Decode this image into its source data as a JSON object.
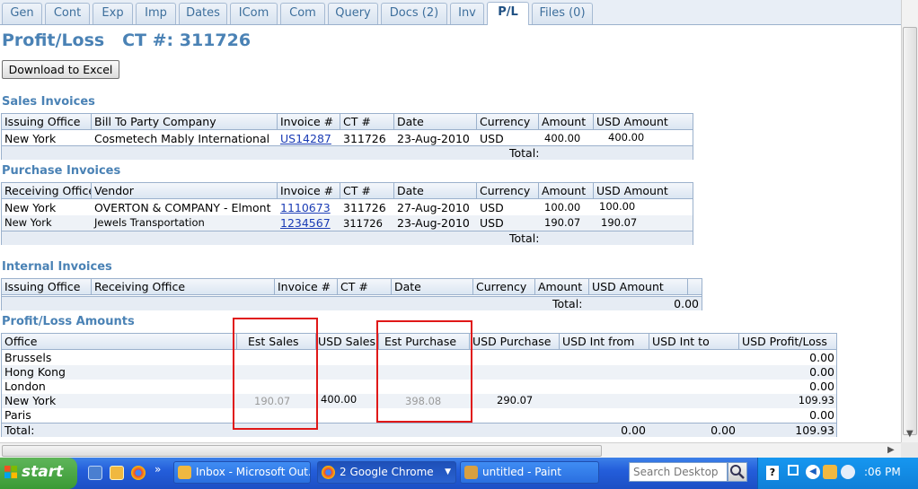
{
  "tabs": [
    {
      "label": "Gen"
    },
    {
      "label": "Cont"
    },
    {
      "label": "Exp"
    },
    {
      "label": "Imp"
    },
    {
      "label": "Dates"
    },
    {
      "label": "ICom"
    },
    {
      "label": "Com"
    },
    {
      "label": "Query"
    },
    {
      "label": "Docs (2)"
    },
    {
      "label": "Inv"
    },
    {
      "label": "P/L"
    },
    {
      "label": "Files (0)"
    }
  ],
  "active_tab": "P/L",
  "page": {
    "title": "Profit/Loss   CT #: 311726",
    "excel_button": "Download to Excel"
  },
  "sales": {
    "title": "Sales Invoices",
    "headers": [
      "Issuing Office",
      "Bill To Party Company",
      "Invoice #",
      "CT #",
      "Date",
      "Currency",
      "Amount",
      "USD Amount"
    ],
    "rows": [
      {
        "office": "New York",
        "company": "Cosmetech Mably International",
        "invoice": "US14287",
        "ct": "311726",
        "date": "23-Aug-2010",
        "currency": "USD",
        "amount": "400.00",
        "usd": "400.00"
      }
    ],
    "total_label": "Total:"
  },
  "purchase": {
    "title": "Purchase Invoices",
    "headers": [
      "Receiving Office",
      "Vendor",
      "Invoice #",
      "CT #",
      "Date",
      "Currency",
      "Amount",
      "USD Amount"
    ],
    "rows": [
      {
        "office": "New York",
        "vendor": "OVERTON & COMPANY - Elmont",
        "invoice": "1110673",
        "ct": "311726",
        "date": "27-Aug-2010",
        "currency": "USD",
        "amount": "100.00",
        "usd": "100.00"
      },
      {
        "office": "New York",
        "vendor": "Jewels Transportation",
        "invoice": "1234567",
        "ct": "311726",
        "date": "23-Aug-2010",
        "currency": "USD",
        "amount": "190.07",
        "usd": "190.07"
      }
    ],
    "total_label": "Total:"
  },
  "internal": {
    "title": "Internal Invoices",
    "headers": [
      "Issuing Office",
      "Receiving Office",
      "Invoice #",
      "CT #",
      "Date",
      "Currency",
      "Amount",
      "USD Amount"
    ],
    "total_label": "Total:",
    "total_value": "0.00"
  },
  "pl": {
    "title": "Profit/Loss Amounts",
    "headers": [
      "Office",
      "Est Sales",
      "USD Sales",
      "Est  Purchase",
      "USD Purchase",
      "USD Int from",
      "USD Int to",
      "USD Profit/Loss"
    ],
    "rows": [
      {
        "office": "Brussels",
        "est_sales": "",
        "usd_sales": "",
        "est_purchase": "",
        "usd_purchase": "",
        "profit": "0.00"
      },
      {
        "office": "Hong Kong",
        "est_sales": "",
        "usd_sales": "",
        "est_purchase": "",
        "usd_purchase": "",
        "profit": "0.00"
      },
      {
        "office": "London",
        "est_sales": "",
        "usd_sales": "",
        "est_purchase": "",
        "usd_purchase": "",
        "profit": "0.00"
      },
      {
        "office": "New York",
        "est_sales": "190.07",
        "usd_sales": "400.00",
        "est_purchase": "398.08",
        "usd_purchase": "290.07",
        "profit": "109.93"
      },
      {
        "office": "Paris",
        "est_sales": "",
        "usd_sales": "",
        "est_purchase": "",
        "usd_purchase": "",
        "profit": "0.00"
      }
    ],
    "total_label": "Total:",
    "total_int_from": "0.00",
    "total_int_to": "0.00",
    "total_profit": "109.93"
  },
  "taskbar": {
    "start": "start",
    "tasks": [
      {
        "label": "Inbox - Microsoft Out..."
      },
      {
        "label": "2 Google Chrome"
      },
      {
        "label": "untitled - Paint"
      }
    ],
    "search_placeholder": "Search Desktop",
    "clock": ":06 PM"
  },
  "colors": {
    "accent": "#4a82b5",
    "highlight_box": "#e01818",
    "taskbar": "#245edb"
  }
}
